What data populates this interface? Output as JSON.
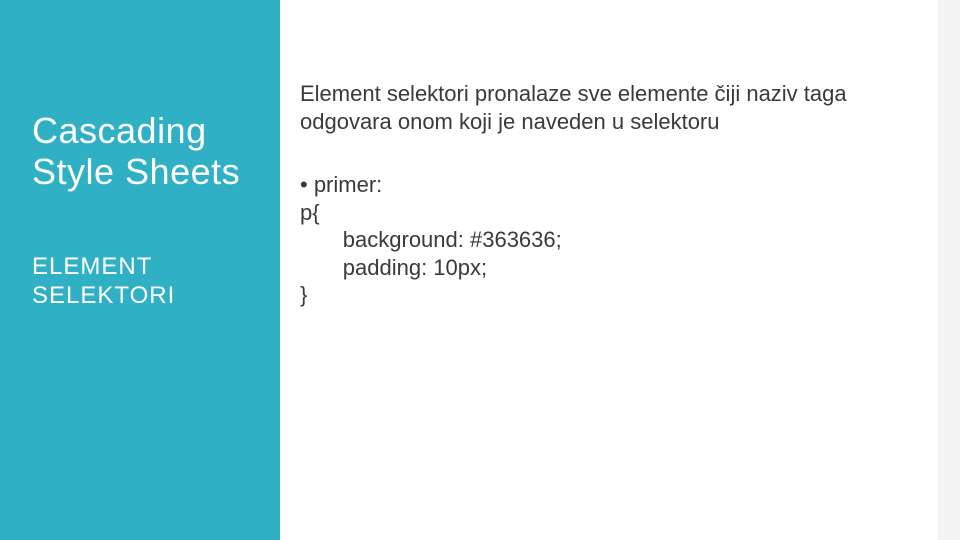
{
  "left": {
    "title1": "Cascading",
    "title2": "Style Sheets",
    "subtitle1": "ELEMENT",
    "subtitle2": "SELEKTORI"
  },
  "content": {
    "description": "Element selektori pronalaze sve elemente čiji naziv taga odgovara onom koji je naveden u selektoru",
    "example_label": "• primer:",
    "code": "p{\n       background: #363636;\n       padding: 10px;\n}"
  }
}
